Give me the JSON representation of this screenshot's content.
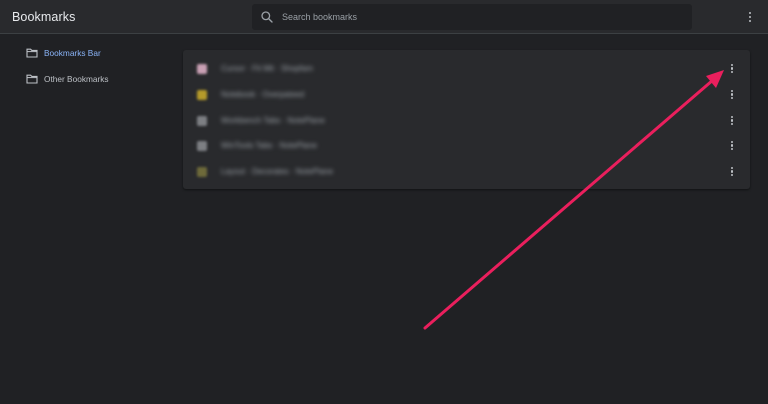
{
  "header": {
    "title": "Bookmarks",
    "search": {
      "placeholder": "Search bookmarks",
      "value": ""
    },
    "menu_icon": "more-vert-icon"
  },
  "sidebar": {
    "items": [
      {
        "label": "Bookmarks Bar",
        "icon": "folder-icon",
        "active": true
      },
      {
        "label": "Other Bookmarks",
        "icon": "folder-icon",
        "active": false
      }
    ]
  },
  "bookmarks": [
    {
      "title": "Cursor · Fit Mit · Shopfam",
      "favicon_color": "#c9a0b4",
      "menu_icon": "more-vert-icon"
    },
    {
      "title": "Notebook · Overpateed",
      "favicon_color": "#b59a2a",
      "menu_icon": "more-vert-icon"
    },
    {
      "title": "Workbench Tabs · NotePlane",
      "favicon_color": "#7d7f83",
      "menu_icon": "more-vert-icon"
    },
    {
      "title": "WinTools Tabs · NotePlane",
      "favicon_color": "#7d7f83",
      "menu_icon": "more-vert-icon"
    },
    {
      "title": "Layout · Decorates · NotePlane",
      "favicon_color": "#6e6a3a",
      "menu_icon": "more-vert-icon"
    }
  ],
  "theme": {
    "background": "#202124",
    "surface": "#292a2d",
    "accent_text": "#8ab4f8",
    "annotation_arrow": "#ea1f5d"
  }
}
